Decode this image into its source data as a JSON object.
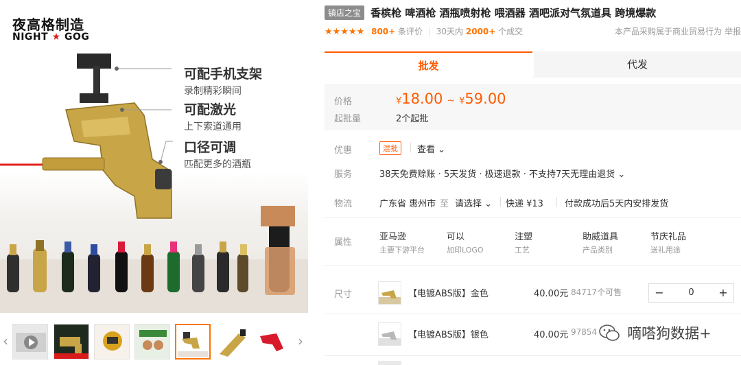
{
  "brand": {
    "name_cn": "夜高格制造",
    "name_en_left": "NIGHT",
    "name_en_star": "★",
    "name_en_right": "GOG"
  },
  "features": [
    {
      "title": "可配手机支架",
      "subtitle": "录制精彩瞬间"
    },
    {
      "title": "可配激光",
      "subtitle": "上下索道通用"
    },
    {
      "title": "口径可调",
      "subtitle": "匹配更多的酒瓶"
    }
  ],
  "gallery": {
    "prev": "‹",
    "next": "›",
    "active_index": 4,
    "count": 7
  },
  "product": {
    "shop_badge": "镇店之宝",
    "title": "香槟枪 啤酒枪 酒瓶喷射枪 喂酒器 酒吧派对气氛道具 跨境爆款",
    "stars": "★★★★★",
    "review_count": "800+",
    "review_label": "条评价",
    "sales_prefix": "30天内",
    "sales_count": "2000+",
    "sales_label": "个成交",
    "trade_note": "本产品采购属于商业贸易行为",
    "report_label": "举报"
  },
  "tabs": {
    "wholesale": "批发",
    "dropship": "代发"
  },
  "price": {
    "label": "价格",
    "currency": "¥",
    "min": "18.00",
    "tilde": "~",
    "max": "59.00",
    "moq_label": "起批量",
    "moq_value": "2个起批"
  },
  "promo": {
    "label": "优惠",
    "badge": "混批",
    "view": "查看 ⌄"
  },
  "service": {
    "label": "服务",
    "text": "38天免费赊账 · 5天发货 · 极速退款 · 不支持7天无理由退货 ⌄"
  },
  "logistics": {
    "label": "物流",
    "origin": "广东省 惠州市",
    "to": "至",
    "dest": "请选择 ⌄",
    "express": "快递 ¥13",
    "ship_note": "付款成功后5天内安排发货"
  },
  "attributes": {
    "label": "属性",
    "items": [
      {
        "value": "亚马逊",
        "key": "主要下游平台"
      },
      {
        "value": "可以",
        "key": "加印LOGO"
      },
      {
        "value": "注塑",
        "key": "工艺"
      },
      {
        "value": "助威道具",
        "key": "产品类别"
      },
      {
        "value": "节庆礼品",
        "key": "送礼用途"
      }
    ]
  },
  "sku": {
    "label": "尺寸",
    "rows": [
      {
        "name": "【电镀ABS版】金色",
        "price": "40.00元",
        "stock": "84717个可售",
        "qty": "0",
        "minus": "−",
        "plus": "+"
      },
      {
        "name": "【电镀ABS版】银色",
        "price": "40.00元",
        "stock": "97854"
      }
    ]
  },
  "watermark": {
    "text": "嘀嗒狗数据+"
  },
  "colors": {
    "accent": "#ff5a00",
    "star": "#ff7300",
    "badge_gray": "#8c8c8c"
  }
}
